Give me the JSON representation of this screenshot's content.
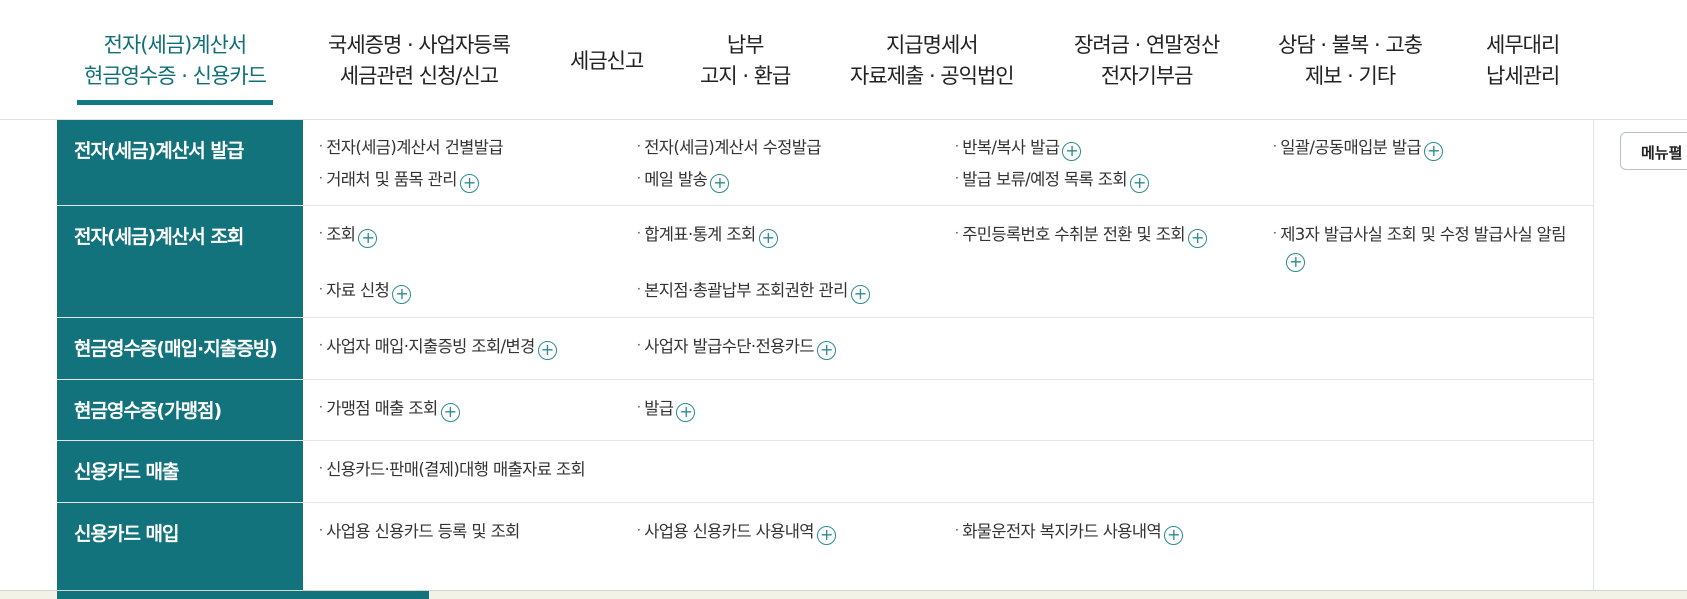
{
  "topnav": {
    "tabs": [
      {
        "line1": "전자(세금)계산서",
        "line2": "현금영수증 · 신용카드"
      },
      {
        "line1": "국세증명 · 사업자등록",
        "line2": "세금관련 신청/신고"
      },
      {
        "line1": "세금신고",
        "line2": ""
      },
      {
        "line1": "납부",
        "line2": "고지 · 환급"
      },
      {
        "line1": "지급명세서",
        "line2": "자료제출 · 공익법인"
      },
      {
        "line1": "장려금 · 연말정산",
        "line2": "전자기부금"
      },
      {
        "line1": "상담 · 불복 · 고충",
        "line2": "제보 · 기타"
      },
      {
        "line1": "세무대리",
        "line2": "납세관리"
      }
    ]
  },
  "menu_button": {
    "label": "메뉴펼"
  },
  "categories": [
    {
      "title": "전자(세금)계산서 발급",
      "items": [
        {
          "label": "전자(세금)계산서 건별발급",
          "plus": false
        },
        {
          "label": "전자(세금)계산서 수정발급",
          "plus": false
        },
        {
          "label": "반복/복사 발급",
          "plus": true
        },
        {
          "label": "일괄/공동매입분 발급",
          "plus": true
        },
        {
          "label": "거래처 및 품목 관리",
          "plus": true
        },
        {
          "label": "메일 발송",
          "plus": true
        },
        {
          "label": "발급 보류/예정 목록 조회",
          "plus": true
        }
      ]
    },
    {
      "title": "전자(세금)계산서 조회",
      "items": [
        {
          "label": "조회",
          "plus": true
        },
        {
          "label": "합계표·통계 조회",
          "plus": true
        },
        {
          "label": "주민등록번호 수취분 전환 및 조회",
          "plus": true
        },
        {
          "label": "제3자 발급사실 조회 및 수정 발급사실 알림",
          "plus": true
        },
        {
          "label": "자료 신청",
          "plus": true
        },
        {
          "label": "본지점·총괄납부 조회권한 관리",
          "plus": true
        }
      ]
    },
    {
      "title": "현금영수증(매입·지출증빙)",
      "items": [
        {
          "label": "사업자 매입·지출증빙 조회/변경",
          "plus": true
        },
        {
          "label": "사업자 발급수단·전용카드",
          "plus": true
        }
      ]
    },
    {
      "title": "현금영수증(가맹점)",
      "items": [
        {
          "label": "가맹점 매출 조회",
          "plus": true
        },
        {
          "label": "발급",
          "plus": true
        }
      ]
    },
    {
      "title": "신용카드 매출",
      "items": [
        {
          "label": "신용카드·판매(결제)대행 매출자료 조회",
          "plus": false
        }
      ]
    },
    {
      "title": "신용카드 매입",
      "items": [
        {
          "label": "사업용 신용카드 등록 및 조회",
          "plus": false
        },
        {
          "label": "사업용 신용카드 사용내역",
          "plus": true
        },
        {
          "label": "화물운전자 복지카드 사용내역",
          "plus": true
        }
      ]
    }
  ],
  "colors": {
    "accent": "#13737c",
    "plus": "#2b8a93",
    "active_tab": "#0f6f78"
  }
}
